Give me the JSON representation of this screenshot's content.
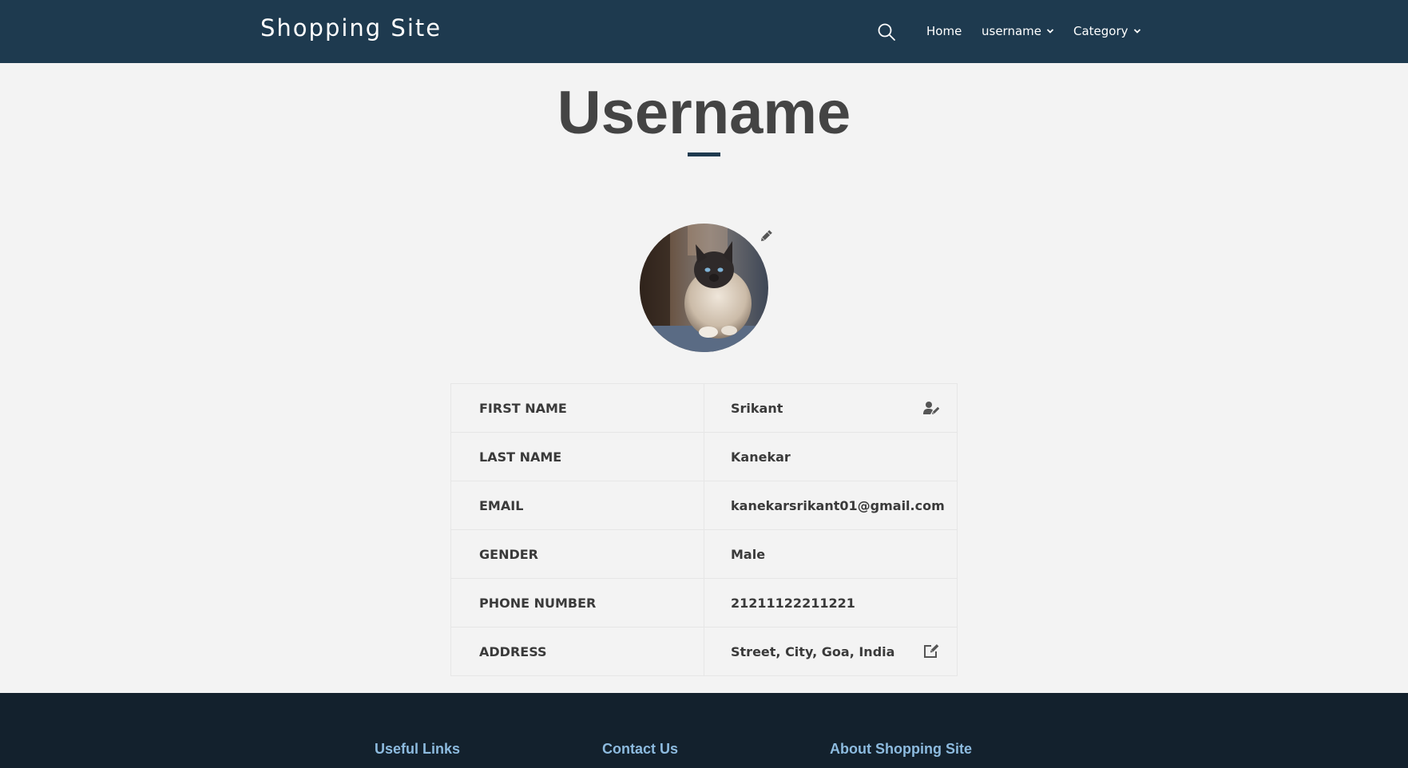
{
  "navbar": {
    "brand": "Shopping Site",
    "icons": {
      "search": "search-icon"
    },
    "links": [
      {
        "label": "Home"
      },
      {
        "label": "username",
        "dropdown": true
      },
      {
        "label": "Category",
        "dropdown": true
      }
    ]
  },
  "page": {
    "title": "Username",
    "accent_color": "#1e3a4f"
  },
  "profile": {
    "avatar_alt": "cat",
    "rows": [
      {
        "label": "FIRST NAME",
        "value": "Srikant",
        "icon": "user-edit-icon"
      },
      {
        "label": "LAST NAME",
        "value": "Kanekar"
      },
      {
        "label": "EMAIL",
        "value": "kanekarsrikant01@gmail.com"
      },
      {
        "label": "GENDER",
        "value": "Male"
      },
      {
        "label": "PHONE NUMBER",
        "value": "21211122211221"
      },
      {
        "label": "ADDRESS",
        "value": "Street, City, Goa, India",
        "icon": "edit-icon"
      }
    ]
  },
  "footer": {
    "headings": [
      "Useful Links",
      "Contact Us",
      "About Shopping Site"
    ],
    "heading_color": "#8dbbdf"
  }
}
